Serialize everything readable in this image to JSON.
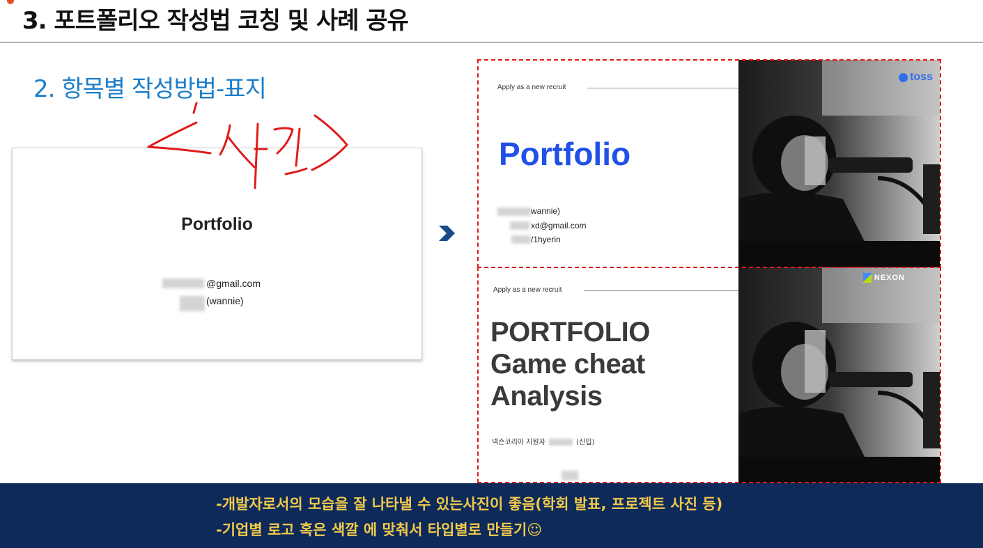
{
  "slide": {
    "title": "3. 포트폴리오 작성법 코칭 및 사례 공유",
    "subtitle": "2. 항목별 작성방법-표지"
  },
  "annotation": {
    "handwriting": "<사진>",
    "color": "#e01b1b"
  },
  "left_example": {
    "title": "Portfolio",
    "email_suffix": "@gmail.com",
    "handle": "(wannie)"
  },
  "arrow_icon": "chevron-right-icon",
  "toss_example": {
    "recruit": "Apply as a new recruit",
    "title": "Portfolio",
    "info_lines": [
      "wannie)",
      "xd@gmail.com",
      "/1hyerin"
    ],
    "logo_text": "toss",
    "accent": "#2050e6"
  },
  "nexon_example": {
    "recruit": "Apply as a new recruit",
    "title_lines": [
      "PORTFOLIO",
      "Game cheat",
      "Analysis"
    ],
    "applicant_prefix": "넥슨코리아 지원자",
    "applicant_suffix": "(신입)",
    "logo_text": "NEXON"
  },
  "caption": {
    "line1": "-개발자로서의 모습을 잘 나타낼 수 있는사진이 좋음(학회 발표, 프로젝트 사진 등)",
    "line2": "-기업별 로고 혹은 색깔 에 맞춰서 타입별로 만들기☺",
    "background": "#0d2a5a",
    "text_color": "#f2c94c"
  }
}
